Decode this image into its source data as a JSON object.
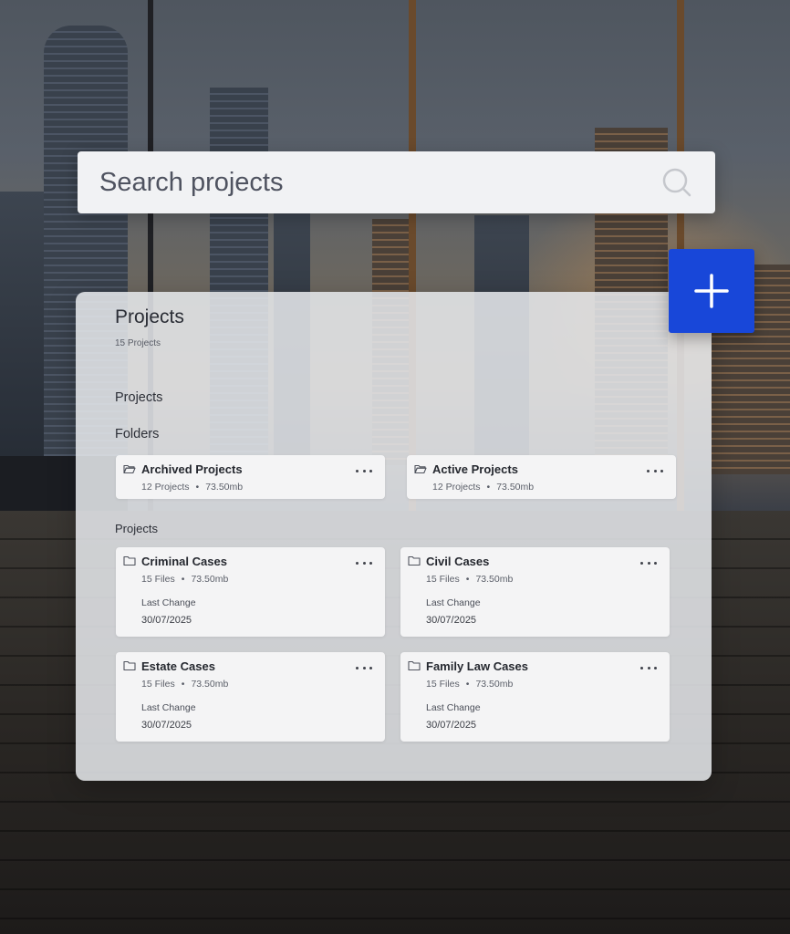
{
  "search": {
    "placeholder": "Search projects"
  },
  "add_button": {
    "icon": "plus-icon",
    "color": "#1847d9"
  },
  "panel": {
    "title": "Projects",
    "count": "15 Projects",
    "tab_label": "Projects",
    "folders_label": "Folders",
    "projects_label": "Projects"
  },
  "folders": [
    {
      "name": "Archived Projects",
      "count": "12 Projects",
      "size": "73.50mb",
      "icon": "folder-open-icon"
    },
    {
      "name": "Active Projects",
      "count": "12 Projects",
      "size": "73.50mb",
      "icon": "folder-open-icon"
    }
  ],
  "projects": [
    {
      "name": "Criminal Cases",
      "files": "15 Files",
      "size": "73.50mb",
      "last_change_label": "Last Change",
      "last_change": "30/07/2025",
      "icon": "folder-icon"
    },
    {
      "name": "Civil Cases",
      "files": "15 Files",
      "size": "73.50mb",
      "last_change_label": "Last Change",
      "last_change": "30/07/2025",
      "icon": "folder-icon"
    },
    {
      "name": "Estate Cases",
      "files": "15 Files",
      "size": "73.50mb",
      "last_change_label": "Last Change",
      "last_change": "30/07/2025",
      "icon": "folder-icon"
    },
    {
      "name": "Family Law Cases",
      "files": "15 Files",
      "size": "73.50mb",
      "last_change_label": "Last Change",
      "last_change": "30/07/2025",
      "icon": "folder-icon"
    }
  ],
  "separator": "•"
}
